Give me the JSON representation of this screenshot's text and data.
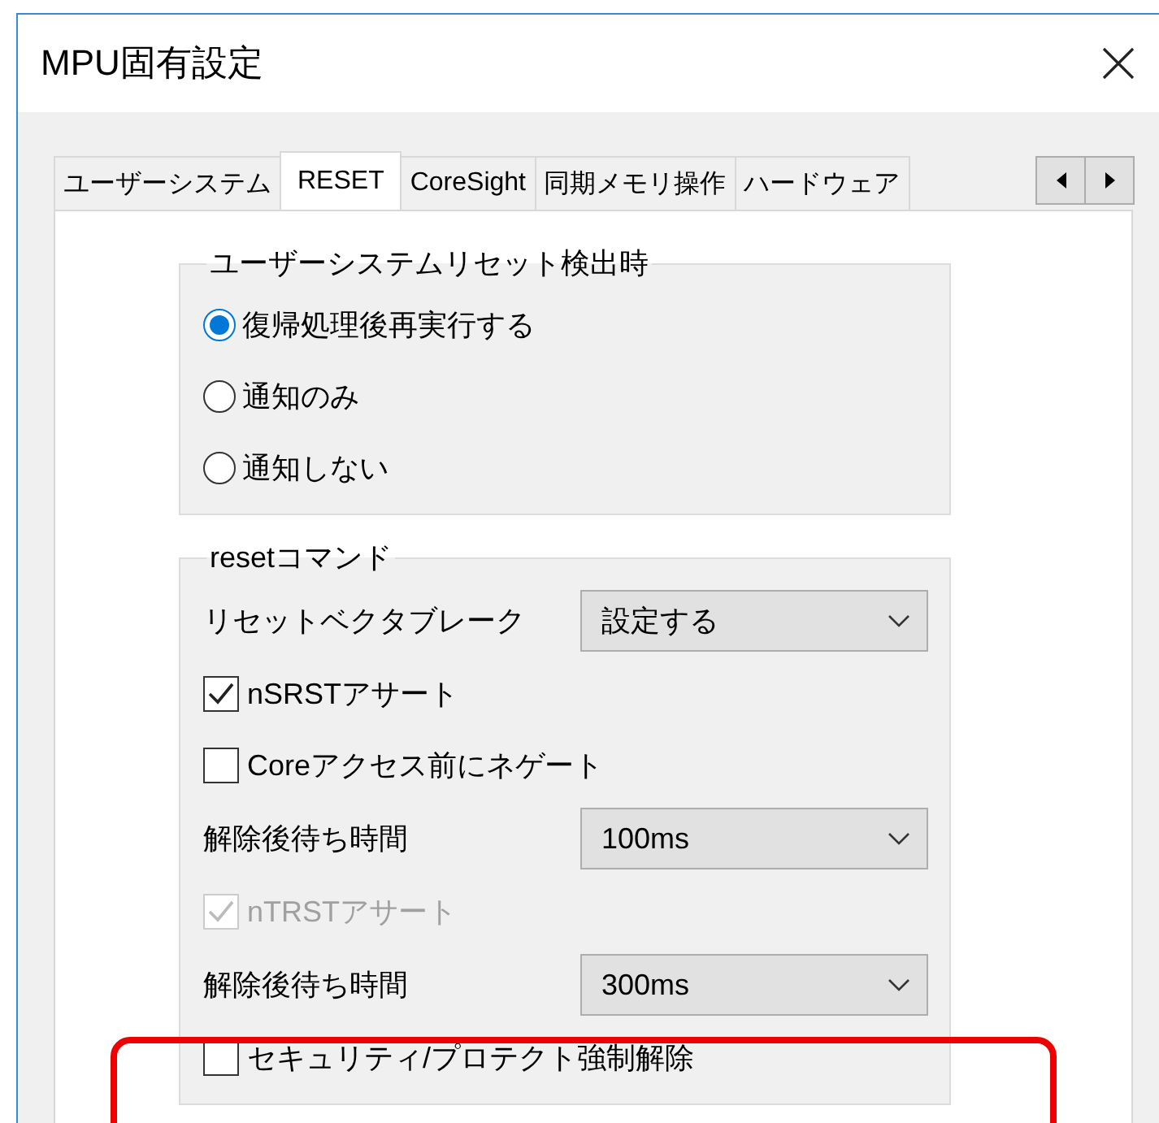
{
  "window": {
    "title": "MPU固有設定"
  },
  "tabs": [
    {
      "label": "ユーザーシステム",
      "selected": false
    },
    {
      "label": "RESET",
      "selected": true
    },
    {
      "label": "CoreSight",
      "selected": false
    },
    {
      "label": "同期メモリ操作",
      "selected": false
    },
    {
      "label": "ハードウェア",
      "selected": false
    }
  ],
  "groups": [
    {
      "title": "ユーザーシステムリセット検出時",
      "items": [
        {
          "kind": "radio",
          "label": "復帰処理後再実行する",
          "selected": true
        },
        {
          "kind": "radio",
          "label": "通知のみ",
          "selected": false
        },
        {
          "kind": "radio",
          "label": "通知しない",
          "selected": false
        }
      ]
    },
    {
      "title": "resetコマンド",
      "items": [
        {
          "kind": "dropdown",
          "label": "リセットベクタブレーク",
          "value": "設定する"
        },
        {
          "kind": "checkbox",
          "label": "nSRSTアサート",
          "checked": true,
          "disabled": false
        },
        {
          "kind": "checkbox",
          "label": "Coreアクセス前にネゲート",
          "checked": false,
          "disabled": false
        },
        {
          "kind": "dropdown",
          "label": "解除後待ち時間",
          "value": "100ms"
        },
        {
          "kind": "checkbox",
          "label": "nTRSTアサート",
          "checked": true,
          "disabled": true
        },
        {
          "kind": "dropdown",
          "label": "解除後待ち時間",
          "value": "300ms"
        },
        {
          "kind": "checkbox",
          "label": "セキュリティ/プロテクト強制解除",
          "checked": false,
          "disabled": false
        }
      ]
    }
  ]
}
